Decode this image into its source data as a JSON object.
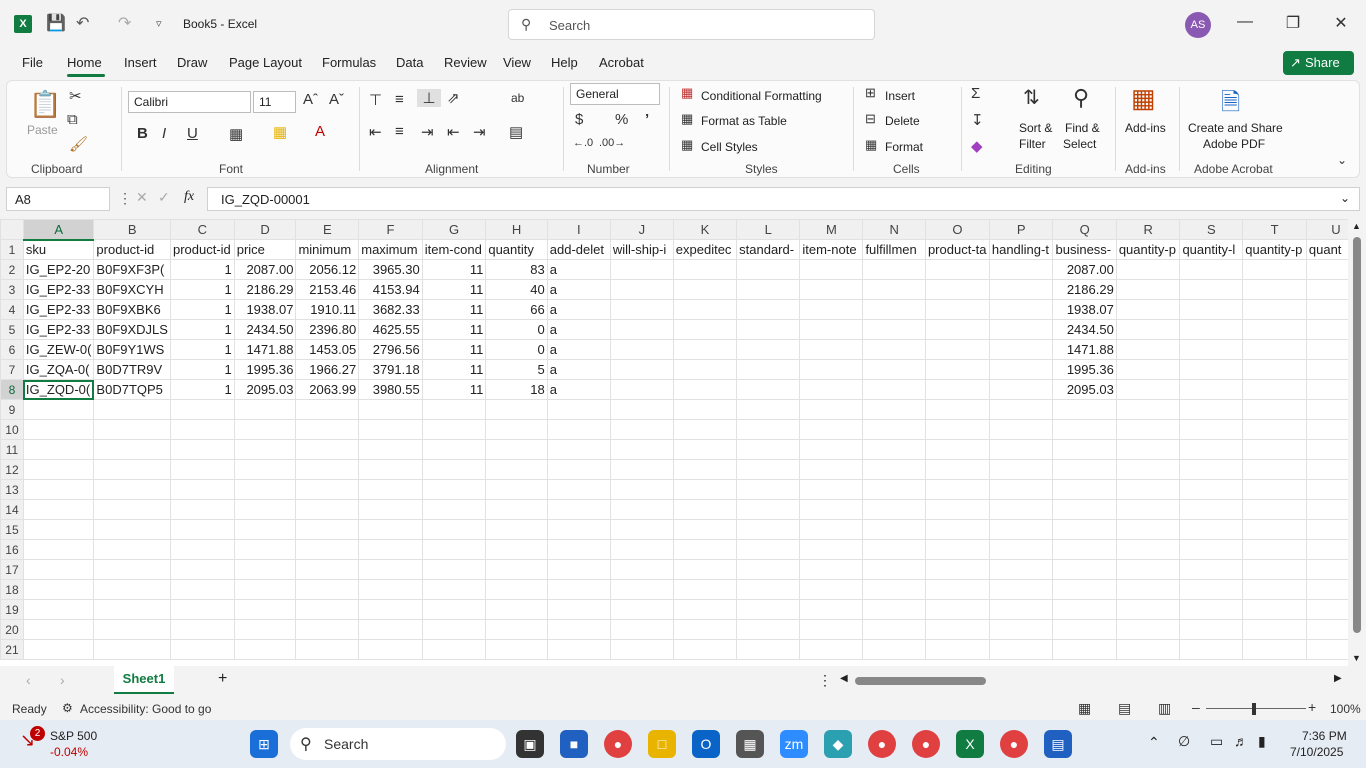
{
  "title_bar": {
    "doc_title": "Book5  -  Excel",
    "search_placeholder": "Search",
    "user_initials": "AS"
  },
  "menu": {
    "items": [
      "File",
      "Home",
      "Insert",
      "Draw",
      "Page Layout",
      "Formulas",
      "Data",
      "Review",
      "View",
      "Help",
      "Acrobat"
    ],
    "share_label": "Share"
  },
  "ribbon": {
    "clipboard": {
      "paste": "Paste",
      "label": "Clipboard"
    },
    "font": {
      "name": "Calibri",
      "size": "11",
      "label": "Font"
    },
    "alignment": {
      "label": "Alignment"
    },
    "number": {
      "format": "General",
      "label": "Number"
    },
    "styles": {
      "conditional": "Conditional Formatting",
      "format_table": "Format as Table",
      "cell_styles": "Cell Styles",
      "label": "Styles"
    },
    "cells": {
      "insert": "Insert",
      "delete": "Delete",
      "format": "Format",
      "label": "Cells"
    },
    "editing": {
      "sort": "Sort &",
      "filter": "Filter",
      "find": "Find &",
      "select": "Select",
      "label": "Editing"
    },
    "addins": {
      "button": "Add-ins",
      "label": "Add-ins"
    },
    "acrobat": {
      "line1": "Create and Share",
      "line2": "Adobe PDF",
      "label": "Adobe Acrobat"
    }
  },
  "formula_bar": {
    "name_box": "A8",
    "fx": "fx",
    "content": "IG_ZQD-00001"
  },
  "columns": [
    "A",
    "B",
    "C",
    "D",
    "E",
    "F",
    "G",
    "H",
    "I",
    "J",
    "K",
    "L",
    "M",
    "N",
    "O",
    "P",
    "Q",
    "R",
    "S",
    "T",
    "U"
  ],
  "rows": [
    [
      "sku",
      "product-id",
      "product-id",
      "price",
      "minimum",
      "maximum",
      "item-cond",
      "quantity",
      "add-delet",
      "will-ship-i",
      "expeditec",
      "standard-",
      "item-note",
      "fulfillmen",
      "product-ta",
      "handling-t",
      "business-",
      "quantity-p",
      "quantity-l",
      "quantity-p",
      "quant"
    ],
    [
      "IG_EP2-20",
      "B0F9XF3P(",
      "1",
      "2087.00",
      "2056.12",
      "3965.30",
      "11",
      "83",
      "a",
      "",
      "",
      "",
      "",
      "",
      "",
      "",
      "2087.00",
      "",
      "",
      "",
      ""
    ],
    [
      "IG_EP2-33",
      "B0F9XCYH",
      "1",
      "2186.29",
      "2153.46",
      "4153.94",
      "11",
      "40",
      "a",
      "",
      "",
      "",
      "",
      "",
      "",
      "",
      "2186.29",
      "",
      "",
      "",
      ""
    ],
    [
      "IG_EP2-33",
      "B0F9XBK6",
      "1",
      "1938.07",
      "1910.11",
      "3682.33",
      "11",
      "66",
      "a",
      "",
      "",
      "",
      "",
      "",
      "",
      "",
      "1938.07",
      "",
      "",
      "",
      ""
    ],
    [
      "IG_EP2-33",
      "B0F9XDJLS",
      "1",
      "2434.50",
      "2396.80",
      "4625.55",
      "11",
      "0",
      "a",
      "",
      "",
      "",
      "",
      "",
      "",
      "",
      "2434.50",
      "",
      "",
      "",
      ""
    ],
    [
      "IG_ZEW-0(",
      "B0F9Y1WS",
      "1",
      "1471.88",
      "1453.05",
      "2796.56",
      "11",
      "0",
      "a",
      "",
      "",
      "",
      "",
      "",
      "",
      "",
      "1471.88",
      "",
      "",
      "",
      ""
    ],
    [
      "IG_ZQA-0(",
      "B0D7TR9V",
      "1",
      "1995.36",
      "1966.27",
      "3791.18",
      "11",
      "5",
      "a",
      "",
      "",
      "",
      "",
      "",
      "",
      "",
      "1995.36",
      "",
      "",
      "",
      ""
    ],
    [
      "IG_ZQD-0(",
      "B0D7TQP5",
      "1",
      "2095.03",
      "2063.99",
      "3980.55",
      "11",
      "18",
      "a",
      "",
      "",
      "",
      "",
      "",
      "",
      "",
      "2095.03",
      "",
      "",
      "",
      ""
    ]
  ],
  "empty_row_numbers": [
    "9",
    "10",
    "11",
    "12",
    "13",
    "14",
    "15",
    "16",
    "17",
    "18",
    "19",
    "20",
    "21"
  ],
  "sheets": {
    "active": "Sheet1"
  },
  "status": {
    "ready": "Ready",
    "accessibility": "Accessibility: Good to go",
    "zoom": "100%"
  },
  "taskbar": {
    "stock_name": "S&P 500",
    "stock_change": "-0.04%",
    "stock_badge": "2",
    "search": "Search",
    "time": "7:36 PM",
    "date": "7/10/2025"
  }
}
